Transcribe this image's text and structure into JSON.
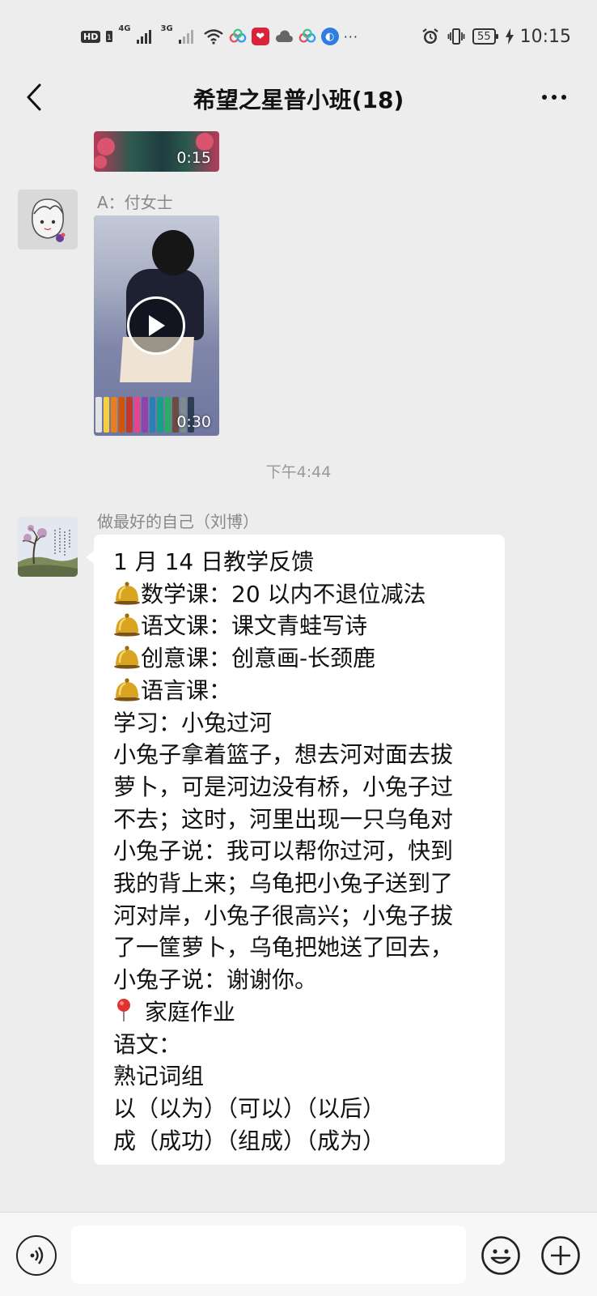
{
  "status_bar": {
    "network_badge": "HD",
    "sim1_label": "4G",
    "sim2_label": "3G",
    "battery_level": "55",
    "time": "10:15",
    "icons": [
      "hd-icon",
      "sim-icon",
      "signal-4g-icon",
      "signal-3g-icon",
      "wifi-icon",
      "app-icon",
      "app-icon",
      "cloud-icon",
      "app-icon",
      "app-icon",
      "more-dots-icon",
      "alarm-icon",
      "vibrate-icon",
      "battery-icon",
      "charging-icon"
    ]
  },
  "header": {
    "title": "希望之星普小班(18)"
  },
  "messages": [
    {
      "type": "video",
      "duration": "0:15"
    },
    {
      "type": "video",
      "sender": "A：付女士",
      "duration": "0:30"
    },
    {
      "type": "timestamp",
      "text": "下午4:44"
    },
    {
      "type": "text",
      "sender": "做最好的自己（刘博）",
      "lines": [
        "1 月 14 日教学反馈",
        "数学课：20 以内不退位减法",
        "语文课：课文青蛙写诗",
        "创意课：创意画-长颈鹿",
        "语言课：",
        "学习：小兔过河",
        "小兔子拿着篮子，想去河对面去拔",
        "萝卜，可是河边没有桥，小兔子过",
        "不去；这时，河里出现一只乌龟对",
        "小兔子说：我可以帮你过河，快到",
        "我的背上来；乌龟把小兔子送到了",
        "河对岸，小兔子很高兴；小兔子拔",
        "了一筐萝卜，乌龟把她送了回去，",
        "小兔子说：谢谢你。",
        "家庭作业",
        "语文：",
        "熟记词组",
        "以（以为）（可以）（以后）",
        "成（成功）（组成）（成为）"
      ]
    }
  ],
  "input_bar": {
    "input_value": ""
  }
}
